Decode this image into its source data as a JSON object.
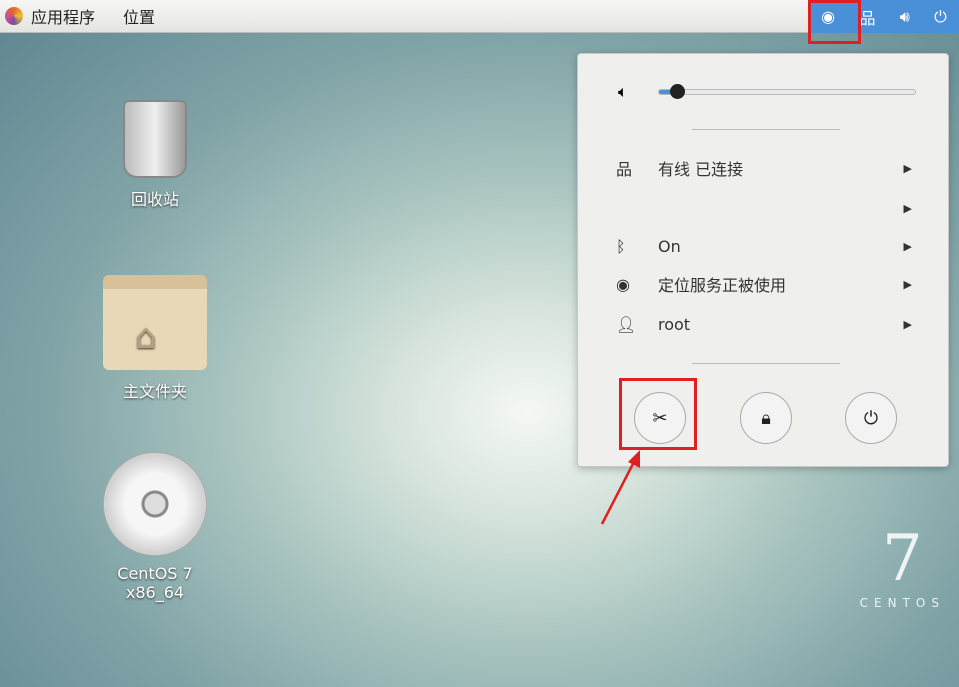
{
  "topbar": {
    "applications": "应用程序",
    "places": "位置",
    "tray": {
      "location": "location-icon",
      "network": "network-wired-icon",
      "volume": "volume-icon",
      "power": "power-icon"
    }
  },
  "desktop": [
    {
      "label": "回收站",
      "icon": "trash-icon"
    },
    {
      "label": "主文件夹",
      "icon": "home-folder-icon"
    },
    {
      "label": "CentOS 7 x86_64",
      "icon": "disc-icon"
    }
  ],
  "popup": {
    "volume_level": 0.07,
    "items": [
      {
        "icon": "network-wired-icon",
        "label": "有线 已连接"
      },
      {
        "icon": "blank",
        "label": ""
      },
      {
        "icon": "bluetooth-icon",
        "label": "On"
      },
      {
        "icon": "location-icon",
        "label": "定位服务正被使用"
      },
      {
        "icon": "user-icon",
        "label": "root"
      }
    ],
    "buttons": [
      "settings",
      "lock",
      "power-off"
    ]
  },
  "watermark": {
    "number": "7",
    "text": "CENTOS"
  },
  "colors": {
    "accent": "#4a90d9",
    "highlight": "#e02020"
  }
}
